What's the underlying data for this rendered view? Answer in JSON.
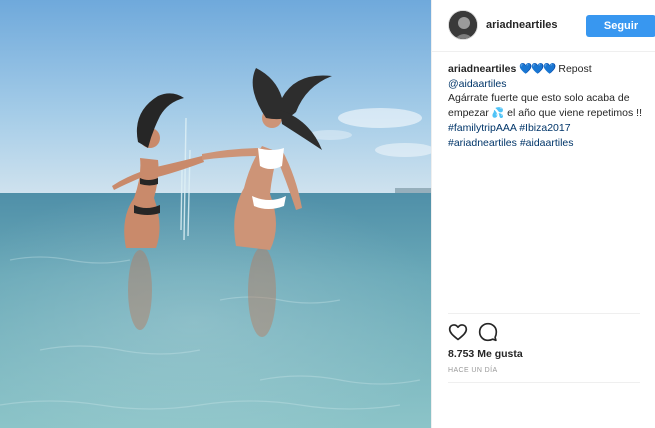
{
  "post": {
    "username": "ariadneartiles",
    "follow_label": "Seguir",
    "caption": {
      "author": "ariadneartiles",
      "hearts": "💙💙💙",
      "repost_label": "Repost",
      "mention": "@aidaartiles",
      "line_1": "Agárrate fuerte que esto solo acaba de",
      "line_2a": "empezar",
      "droplet": "💦",
      "line_2b": "el año que viene repetimos !!",
      "hashtag_1": "#familytripAAA",
      "hashtag_2": "#Ibiza2017",
      "hashtag_3": "#ariadneartiles",
      "hashtag_4": "#aidaartiles"
    },
    "likes": "8.753 Me gusta",
    "timestamp": "HACE UN DÍA"
  },
  "icons": {
    "like": "heart-icon",
    "comment": "comment-bubble-icon",
    "avatar": "profile-avatar"
  },
  "colors": {
    "follow_button": "#3897f0",
    "link": "#003569",
    "timestamp": "#999999",
    "sky": "#8fc1e6",
    "sea": "#5ea3b4"
  }
}
